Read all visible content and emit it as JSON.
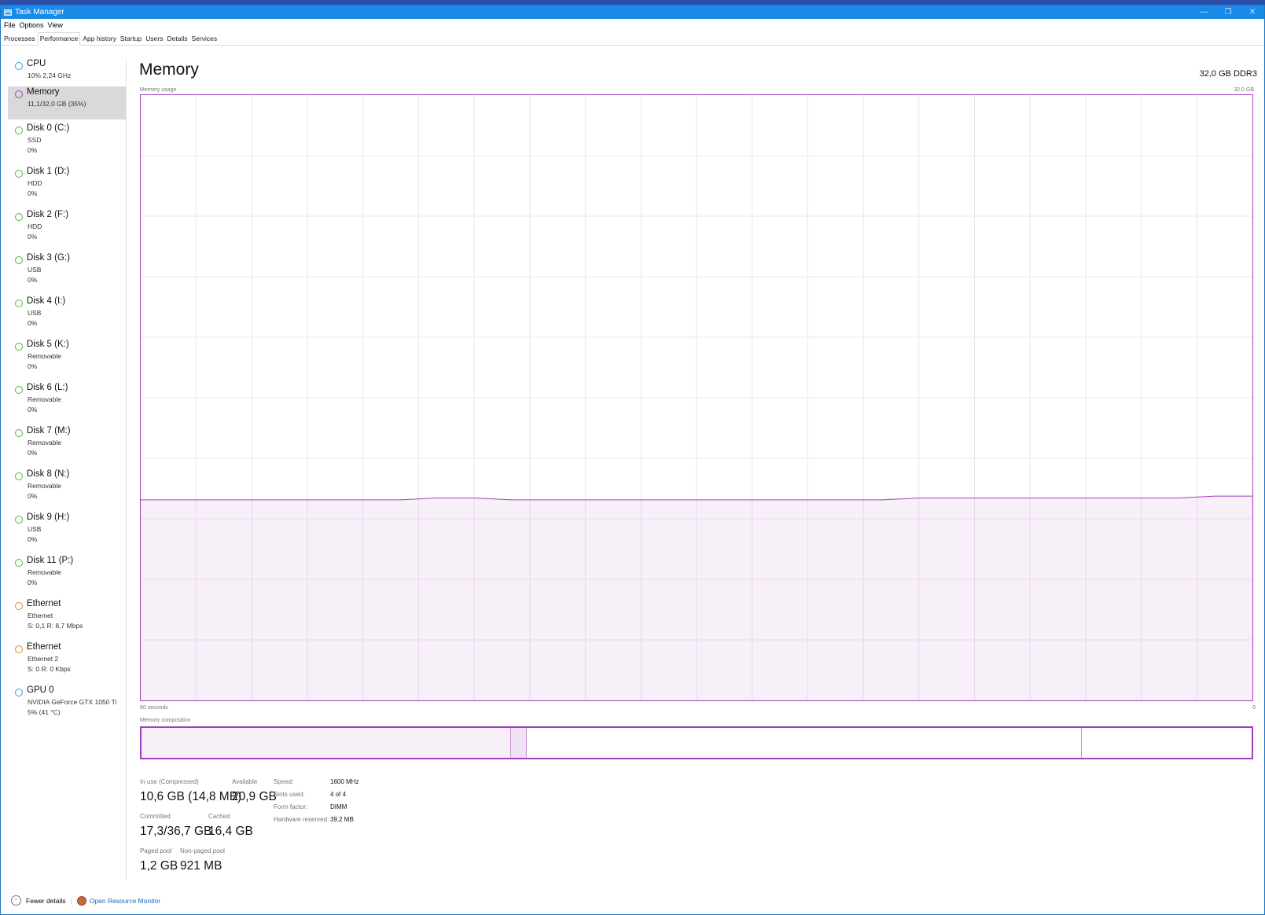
{
  "window": {
    "title": "Task Manager"
  },
  "menu": [
    "File",
    "Options",
    "View"
  ],
  "tabs": [
    {
      "label": "Processes",
      "active": false
    },
    {
      "label": "Performance",
      "active": true
    },
    {
      "label": "App history",
      "active": false
    },
    {
      "label": "Startup",
      "active": false
    },
    {
      "label": "Users",
      "active": false
    },
    {
      "label": "Details",
      "active": false
    },
    {
      "label": "Services",
      "active": false
    }
  ],
  "sidebar": [
    {
      "title": "CPU",
      "lines": [
        "10% 2,24 GHz"
      ],
      "color": "#3e9fd8",
      "selected": false
    },
    {
      "title": "Memory",
      "lines": [
        "11,1/32,0 GB (35%)"
      ],
      "color": "#a13fb8",
      "selected": true
    },
    {
      "title": "Disk 0 (C:)",
      "lines": [
        "SSD",
        "0%"
      ],
      "color": "#56b33f",
      "selected": false
    },
    {
      "title": "Disk 1 (D:)",
      "lines": [
        "HDD",
        "0%"
      ],
      "color": "#56b33f",
      "selected": false
    },
    {
      "title": "Disk 2 (F:)",
      "lines": [
        "HDD",
        "0%"
      ],
      "color": "#56b33f",
      "selected": false
    },
    {
      "title": "Disk 3 (G:)",
      "lines": [
        "USB",
        "0%"
      ],
      "color": "#56b33f",
      "selected": false
    },
    {
      "title": "Disk 4 (I:)",
      "lines": [
        "USB",
        "0%"
      ],
      "color": "#56b33f",
      "selected": false
    },
    {
      "title": "Disk 5 (K:)",
      "lines": [
        "Removable",
        "0%"
      ],
      "color": "#56b33f",
      "selected": false
    },
    {
      "title": "Disk 6 (L:)",
      "lines": [
        "Removable",
        "0%"
      ],
      "color": "#56b33f",
      "selected": false
    },
    {
      "title": "Disk 7 (M:)",
      "lines": [
        "Removable",
        "0%"
      ],
      "color": "#56b33f",
      "selected": false
    },
    {
      "title": "Disk 8 (N:)",
      "lines": [
        "Removable",
        "0%"
      ],
      "color": "#56b33f",
      "selected": false
    },
    {
      "title": "Disk 9 (H:)",
      "lines": [
        "USB",
        "0%"
      ],
      "color": "#56b33f",
      "selected": false
    },
    {
      "title": "Disk 11 (P:)",
      "lines": [
        "Removable",
        "0%"
      ],
      "color": "#56b33f",
      "selected": false
    },
    {
      "title": "Ethernet",
      "lines": [
        "Ethernet",
        "S: 0,1  R: 8,7 Mbps"
      ],
      "color": "#d68b32",
      "selected": false
    },
    {
      "title": "Ethernet",
      "lines": [
        "Ethernet 2",
        "S: 0  R: 0 Kbps"
      ],
      "color": "#d68b32",
      "selected": false
    },
    {
      "title": "GPU 0",
      "lines": [
        "NVIDIA GeForce GTX 1050 Ti",
        "5% (41 °C)"
      ],
      "color": "#3e9fd8",
      "selected": false
    }
  ],
  "main": {
    "title": "Memory",
    "ram_type": "32,0 GB DDR3",
    "usage_label": "Memory usage",
    "usage_max": "32,0 GB",
    "time_left": "60 seconds",
    "time_right": "0",
    "composition_label": "Memory composition"
  },
  "chart_data": {
    "type": "area",
    "title": "Memory usage",
    "xlabel": "60 seconds",
    "ylabel": "",
    "ylim": [
      0,
      32
    ],
    "x": [
      60,
      58,
      56,
      54,
      52,
      50,
      48,
      46,
      44,
      42,
      40,
      38,
      36,
      34,
      32,
      30,
      28,
      26,
      24,
      22,
      20,
      18,
      16,
      14,
      12,
      10,
      8,
      6,
      4,
      2,
      0
    ],
    "values": [
      10.6,
      10.6,
      10.6,
      10.6,
      10.6,
      10.6,
      10.6,
      10.6,
      10.7,
      10.7,
      10.6,
      10.6,
      10.6,
      10.6,
      10.6,
      10.6,
      10.6,
      10.6,
      10.6,
      10.6,
      10.6,
      10.7,
      10.7,
      10.7,
      10.7,
      10.7,
      10.7,
      10.7,
      10.7,
      10.8,
      10.8
    ],
    "grid": true,
    "color": "#a13fb8"
  },
  "composition": {
    "in_use_fraction": 0.333,
    "modified_fraction": 0.014,
    "standby_fraction": 0.5,
    "free_fraction": 0.153
  },
  "stats": {
    "in_use_label": "In use (Compressed)",
    "in_use_value": "10,6 GB (14,8 MB)",
    "available_label": "Available",
    "available_value": "20,9 GB",
    "committed_label": "Committed",
    "committed_value": "17,3/36,7 GB",
    "cached_label": "Cached",
    "cached_value": "16,4 GB",
    "paged_label": "Paged pool",
    "paged_value": "1,2 GB",
    "nonpaged_label": "Non-paged pool",
    "nonpaged_value": "921 MB"
  },
  "specs": [
    {
      "label": "Speed:",
      "value": "1600 MHz"
    },
    {
      "label": "Slots used:",
      "value": "4 of 4"
    },
    {
      "label": "Form factor:",
      "value": "DIMM"
    },
    {
      "label": "Hardware reserved:",
      "value": "39,2 MB"
    }
  ],
  "footer": {
    "fewer_details": "Fewer details",
    "resource_monitor": "Open Resource Monitor"
  }
}
